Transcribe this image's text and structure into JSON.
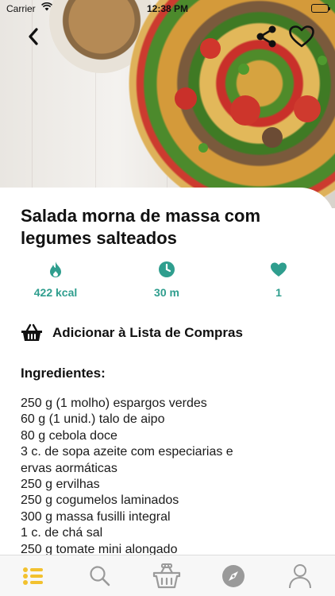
{
  "status_bar": {
    "carrier": "Carrier",
    "time": "12:38 PM"
  },
  "recipe": {
    "title": "Salada morna de massa com legumes salteados",
    "stats": [
      {
        "icon": "flame-icon",
        "value": "422 kcal"
      },
      {
        "icon": "clock-icon",
        "value": "30 m"
      },
      {
        "icon": "heart-icon",
        "value": "1"
      }
    ],
    "shopping_list_label": "Adicionar à Lista de Compras",
    "ingredients_title": "Ingredientes:",
    "ingredients": [
      "250 g (1 molho) espargos verdes",
      "60 g (1 unid.) talo de aipo",
      "80 g cebola doce",
      "3 c. de sopa azeite com especiarias e",
      "ervas aormáticas",
      "250 g ervilhas",
      "250 g cogumelos laminados",
      "300 g massa fusilli integral",
      "1 c. de chá sal",
      "250 g tomate mini alongado"
    ]
  },
  "tabbar": {
    "tabs": [
      {
        "icon": "list-icon",
        "active": true
      },
      {
        "icon": "search-icon",
        "active": false
      },
      {
        "icon": "basket-icon",
        "active": false
      },
      {
        "icon": "compass-icon",
        "active": false
      },
      {
        "icon": "profile-icon",
        "active": false
      }
    ]
  },
  "colors": {
    "accent": "#2f9e8e",
    "active_tab": "#f2c12e",
    "inactive_tab": "#9a9a9a"
  }
}
